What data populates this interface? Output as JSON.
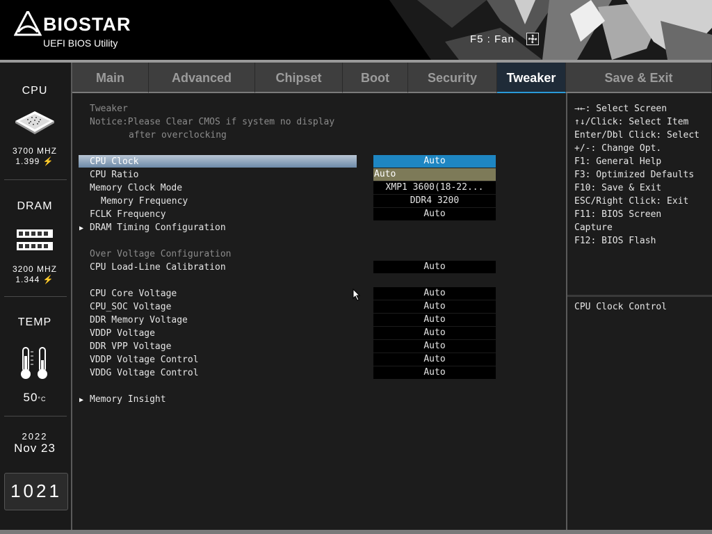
{
  "header": {
    "brand": "BIOSTAR",
    "subtitle": "UEFI BIOS Utility",
    "fan_hint": "F5 : Fan",
    "fan_icon": "fan-icon"
  },
  "sidebar": {
    "cpu": {
      "title": "CPU",
      "freq": "3700 MHZ",
      "volt": "1.399",
      "icon": "cpu-chip-icon"
    },
    "dram": {
      "title": "DRAM",
      "freq": "3200 MHZ",
      "volt": "1.344",
      "icon": "memory-module-icon"
    },
    "temp": {
      "title": "TEMP",
      "value": "50",
      "unit": "°C",
      "icon": "thermometer-icon"
    },
    "date": {
      "year": "2022",
      "month_day": "Nov 23"
    },
    "clock": "1021"
  },
  "tabs": [
    {
      "label": "Main",
      "active": false
    },
    {
      "label": "Advanced",
      "active": false
    },
    {
      "label": "Chipset",
      "active": false
    },
    {
      "label": "Boot",
      "active": false
    },
    {
      "label": "Security",
      "active": false
    },
    {
      "label": "Tweaker",
      "active": true
    },
    {
      "label": "Save & Exit",
      "active": false
    }
  ],
  "main": {
    "section_title": "Tweaker",
    "notice_line1": "Notice:Please Clear CMOS if system no display",
    "notice_line2": "after overclocking",
    "items": {
      "cpu_clock": {
        "label": "CPU Clock",
        "value": "Auto"
      },
      "cpu_ratio": {
        "label": "CPU Ratio",
        "value": "Auto"
      },
      "memory_clock_mode": {
        "label": "Memory Clock Mode",
        "value": "XMP1 3600(18-22..."
      },
      "memory_frequency": {
        "label": "Memory Frequency",
        "value": "DDR4 3200"
      },
      "fclk_frequency": {
        "label": "FCLK Frequency",
        "value": "Auto"
      },
      "dram_timing": {
        "label": "DRAM Timing Configuration"
      },
      "over_voltage_header": "Over Voltage Configuration",
      "cpu_llc": {
        "label": "CPU Load-Line Calibration",
        "value": "Auto"
      },
      "cpu_core_voltage": {
        "label": "CPU Core Voltage",
        "value": "Auto"
      },
      "cpu_soc_voltage": {
        "label": "CPU_SOC Voltage",
        "value": "Auto"
      },
      "ddr_memory_voltage": {
        "label": "DDR Memory Voltage",
        "value": "Auto"
      },
      "vddp_voltage": {
        "label": "VDDP Voltage",
        "value": "Auto"
      },
      "ddr_vpp_voltage": {
        "label": "DDR VPP Voltage",
        "value": "Auto"
      },
      "vddp_voltage_control": {
        "label": "VDDP Voltage Control",
        "value": "Auto"
      },
      "vddg_voltage_control": {
        "label": "VDDG Voltage Control",
        "value": "Auto"
      },
      "memory_insight": {
        "label": "Memory Insight"
      }
    }
  },
  "help": {
    "keys": [
      "→←: Select Screen",
      "↑↓/Click: Select Item",
      "Enter/Dbl Click: Select",
      "+/-: Change Opt.",
      "F1: General Help",
      "F3: Optimized Defaults",
      "F10: Save & Exit",
      "ESC/Right Click: Exit",
      "F11: BIOS Screen",
      "Capture",
      "F12: BIOS Flash"
    ],
    "description": "CPU Clock Control"
  },
  "colors": {
    "accent_blue": "#1e86c2",
    "edit_olive": "#7d7a58",
    "active_tab_bg": "#1f2b38",
    "inactive_tab_bg": "#3e3e3e"
  }
}
